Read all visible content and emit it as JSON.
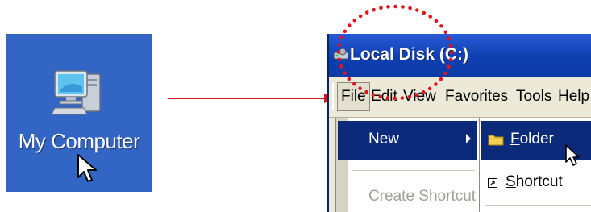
{
  "desktop": {
    "icon_name": "computer-icon",
    "label": "My Computer",
    "background": "#3366c4"
  },
  "window": {
    "title": "Local Disk (C:)",
    "titlebar_color": "#0b3aa5",
    "menu": [
      {
        "pre": "",
        "key": "F",
        "post": "ile"
      },
      {
        "pre": "",
        "key": "E",
        "post": "dit"
      },
      {
        "pre": "",
        "key": "V",
        "post": "iew"
      },
      {
        "pre": "F",
        "key": "a",
        "post": "vorites"
      },
      {
        "pre": "",
        "key": "T",
        "post": "ools"
      },
      {
        "pre": "",
        "key": "H",
        "post": "elp"
      }
    ]
  },
  "file_menu": {
    "new_label": "New",
    "create_shortcut_label": "Create Shortcut"
  },
  "new_submenu": {
    "folder": {
      "key": "F",
      "post": "older"
    },
    "shortcut": {
      "key": "S",
      "post": "hortcut"
    }
  },
  "colors": {
    "annotation": "#e0141e",
    "highlight": "#0b2a7a"
  }
}
